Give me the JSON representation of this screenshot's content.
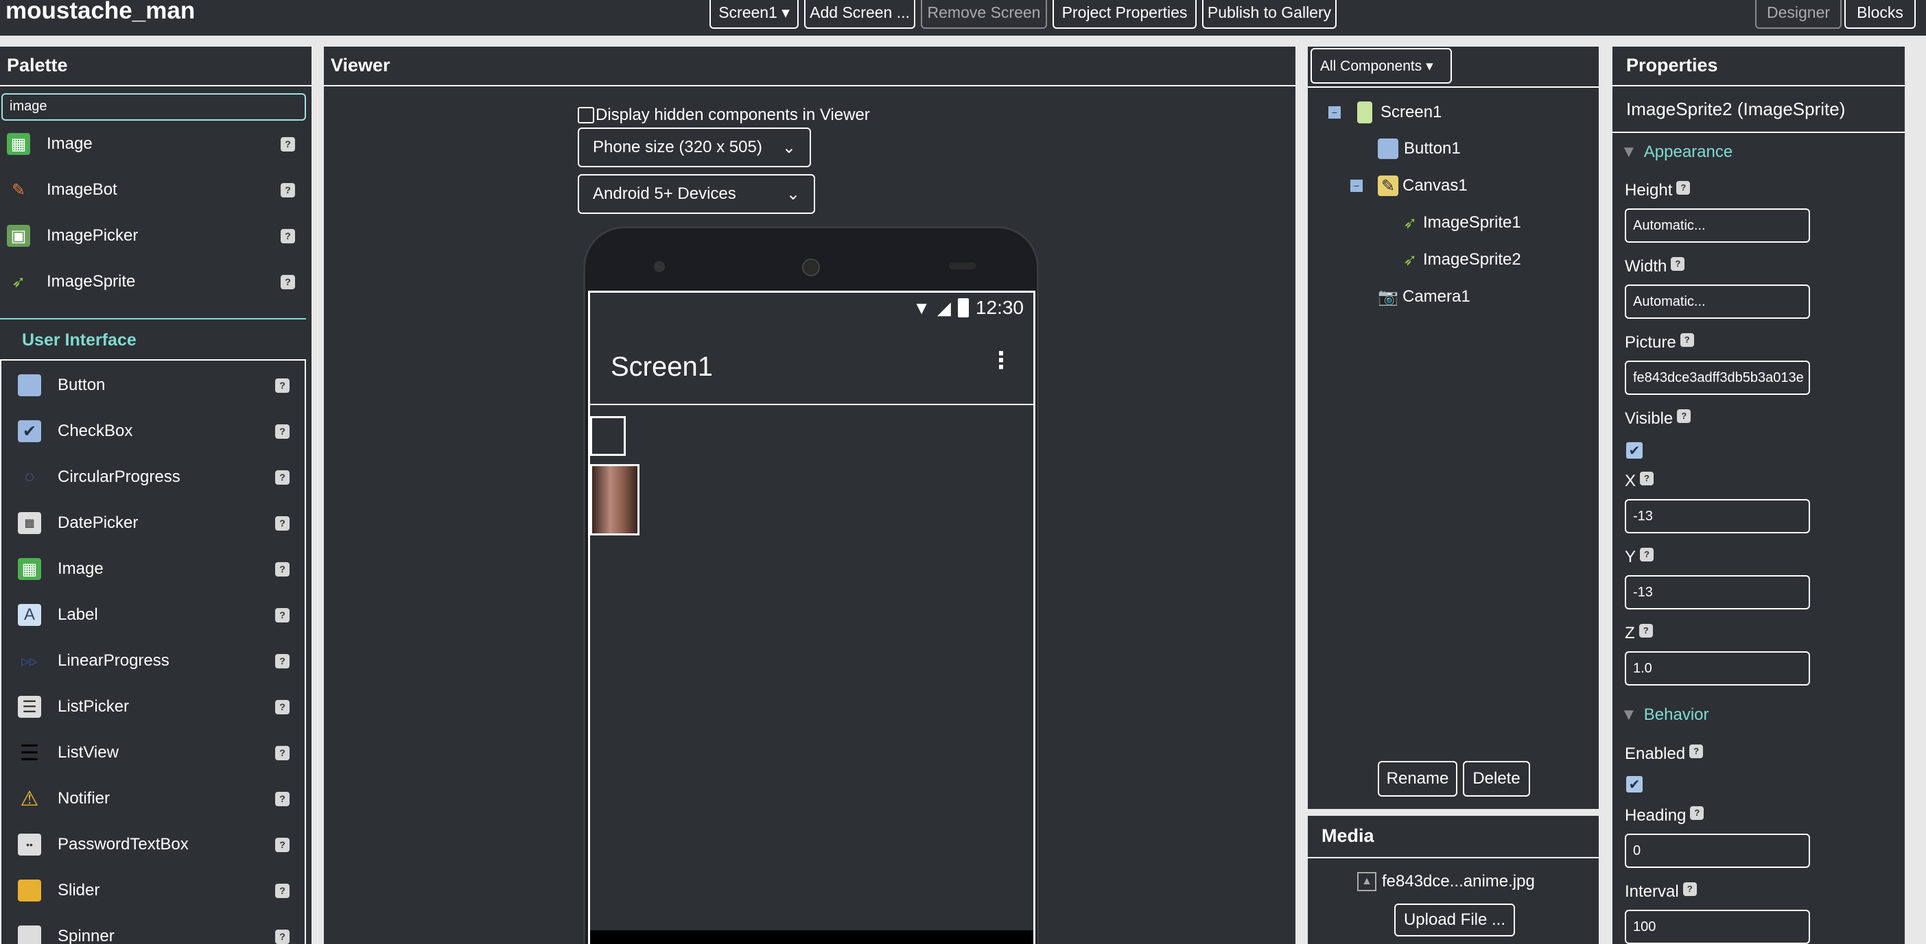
{
  "app": {
    "project_title": "moustache_man"
  },
  "toolbar": {
    "screen_select": "Screen1 ▾",
    "add_screen": "Add Screen ...",
    "remove_screen": "Remove Screen",
    "project_properties": "Project Properties",
    "publish": "Publish to Gallery",
    "designer": "Designer",
    "blocks": "Blocks"
  },
  "palette": {
    "title": "Palette",
    "search_value": "image",
    "results": [
      {
        "label": "Image",
        "icon": "image-icon"
      },
      {
        "label": "ImageBot",
        "icon": "imagebot-icon"
      },
      {
        "label": "ImagePicker",
        "icon": "imagepicker-icon"
      },
      {
        "label": "ImageSprite",
        "icon": "imagesprite-icon"
      }
    ],
    "category": "User Interface",
    "items": [
      {
        "label": "Button",
        "icon": "button-icon"
      },
      {
        "label": "CheckBox",
        "icon": "checkbox-icon"
      },
      {
        "label": "CircularProgress",
        "icon": "circular-progress-icon"
      },
      {
        "label": "DatePicker",
        "icon": "datepicker-icon"
      },
      {
        "label": "Image",
        "icon": "image-icon"
      },
      {
        "label": "Label",
        "icon": "label-icon"
      },
      {
        "label": "LinearProgress",
        "icon": "linear-progress-icon"
      },
      {
        "label": "ListPicker",
        "icon": "listpicker-icon"
      },
      {
        "label": "ListView",
        "icon": "listview-icon"
      },
      {
        "label": "Notifier",
        "icon": "notifier-icon"
      },
      {
        "label": "PasswordTextBox",
        "icon": "password-icon"
      },
      {
        "label": "Slider",
        "icon": "slider-icon"
      },
      {
        "label": "Spinner",
        "icon": "spinner-icon"
      }
    ],
    "help_glyph": "?"
  },
  "viewer": {
    "title": "Viewer",
    "hidden_checkbox_label": "Display hidden components in Viewer",
    "hidden_checked": false,
    "size_select": "Phone size (320 x 505)",
    "device_select": "Android 5+ Devices",
    "status_time": "12:30",
    "screen_title": "Screen1"
  },
  "components": {
    "filter": "All Components ▾",
    "tree": [
      {
        "label": "Screen1",
        "icon": "screen-icon",
        "toggle": "−"
      },
      {
        "label": "Button1",
        "icon": "button-icon"
      },
      {
        "label": "Canvas1",
        "icon": "canvas-icon",
        "toggle": "−"
      },
      {
        "label": "ImageSprite1",
        "icon": "imagesprite-icon"
      },
      {
        "label": "ImageSprite2",
        "icon": "imagesprite-icon"
      },
      {
        "label": "Camera1",
        "icon": "camera-icon"
      }
    ],
    "rename": "Rename",
    "delete": "Delete"
  },
  "media": {
    "title": "Media",
    "file": "fe843dce...anime.jpg",
    "upload": "Upload File ..."
  },
  "properties": {
    "title": "Properties",
    "component": "ImageSprite2 (ImageSprite)",
    "appearance": "Appearance",
    "behavior": "Behavior",
    "height_label": "Height",
    "height_value": "Automatic...",
    "width_label": "Width",
    "width_value": "Automatic...",
    "picture_label": "Picture",
    "picture_value": "fe843dce3adff3db5b3a013e",
    "visible_label": "Visible",
    "visible_checked": true,
    "x_label": "X",
    "x_value": "-13",
    "y_label": "Y",
    "y_value": "-13",
    "z_label": "Z",
    "z_value": "1.0",
    "enabled_label": "Enabled",
    "enabled_checked": true,
    "heading_label": "Heading",
    "heading_value": "0",
    "interval_label": "Interval",
    "interval_value": "100"
  },
  "colors": {
    "panel_bg": "#2d3035",
    "accent_teal": "#7fdbd0",
    "page_bg": "#e8e8e8"
  }
}
